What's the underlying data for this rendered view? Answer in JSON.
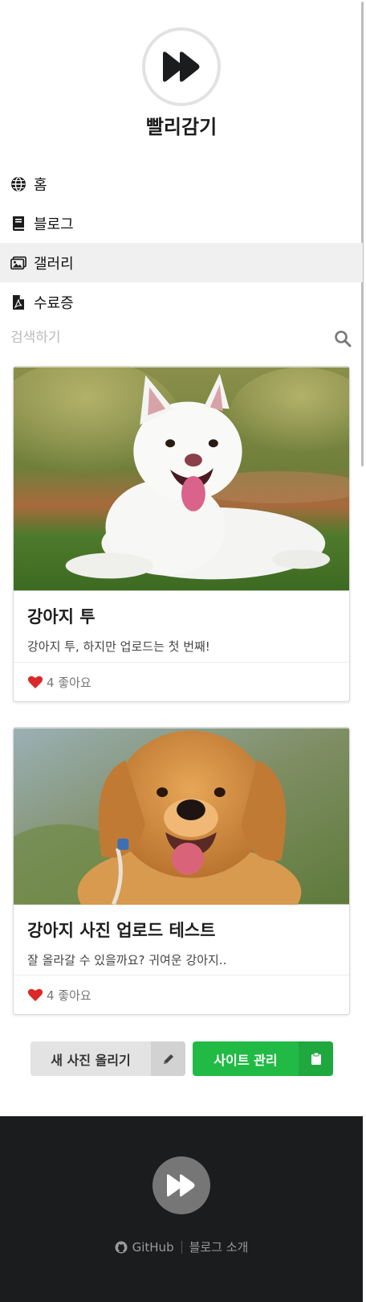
{
  "site": {
    "title": "빨리감기"
  },
  "nav": {
    "items": [
      {
        "label": "홈",
        "icon": "globe-icon"
      },
      {
        "label": "블로그",
        "icon": "book-icon"
      },
      {
        "label": "갤러리",
        "icon": "images-icon",
        "active": true
      },
      {
        "label": "수료증",
        "icon": "file-pdf-icon"
      }
    ]
  },
  "search": {
    "placeholder": "검색하기",
    "icon": "search-icon"
  },
  "posts": [
    {
      "title": "강아지 투",
      "description": "강아지 투, 하지만 업로드는 첫 번째!",
      "likes": "4 좋아요",
      "image": "white-puppy-photo"
    },
    {
      "title": "강아지 사진 업로드 테스트",
      "description": "잘 올라갈 수 있을까요? 귀여운 강아지..",
      "likes": "4 좋아요",
      "image": "golden-puppy-photo"
    }
  ],
  "actions": {
    "upload_label": "새 사진 올리기",
    "upload_icon": "pencil-icon",
    "admin_label": "사이트 관리",
    "admin_icon": "clipboard-icon"
  },
  "footer": {
    "github_label": "GitHub",
    "about_label": "블로그 소개"
  },
  "colors": {
    "accent_green": "#21ba45",
    "footer_bg": "#1b1c1d",
    "heart": "#db2828"
  }
}
